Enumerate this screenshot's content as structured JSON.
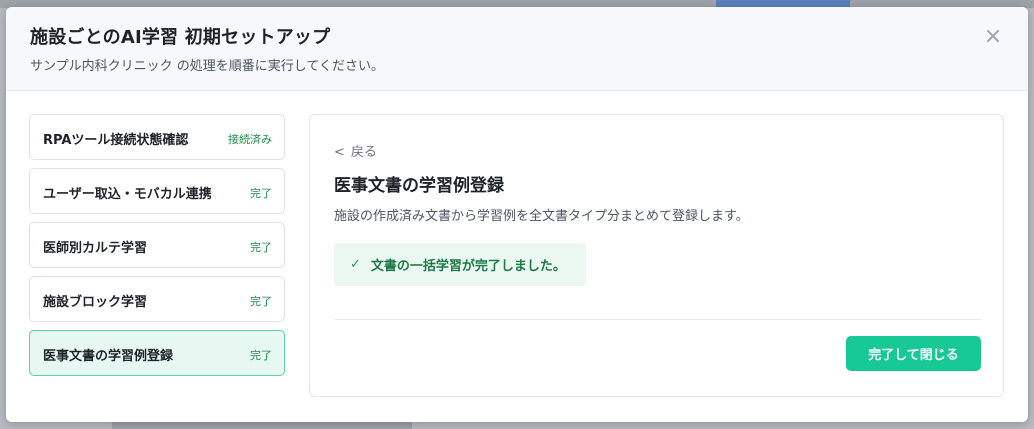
{
  "modal": {
    "title": "施設ごとのAI学習 初期セットアップ",
    "subtitle": "サンプル内科クリニック の処理を順番に実行してください。",
    "close_icon": "×"
  },
  "steps": [
    {
      "label": "RPAツール接続状態確認",
      "status": "接続済み",
      "active": false
    },
    {
      "label": "ユーザー取込・モバカル連携",
      "status": "完了",
      "active": false
    },
    {
      "label": "医師別カルテ学習",
      "status": "完了",
      "active": false
    },
    {
      "label": "施設ブロック学習",
      "status": "完了",
      "active": false
    },
    {
      "label": "医事文書の学習例登録",
      "status": "完了",
      "active": true
    }
  ],
  "content": {
    "back_chevron": "<",
    "back_label": "戻る",
    "title": "医事文書の学習例登録",
    "description": "施設の作成済み文書から学習例を全文書タイプ分まとめて登録します。",
    "success_check": "✓",
    "success_message": "文書の一括学習が完了しました。",
    "done_button": "完了して閉じる"
  },
  "colors": {
    "accent": "#16c995",
    "status_green": "#1f8c4a",
    "active_bg": "#e7f7f1",
    "active_border": "#5cd0a9"
  }
}
